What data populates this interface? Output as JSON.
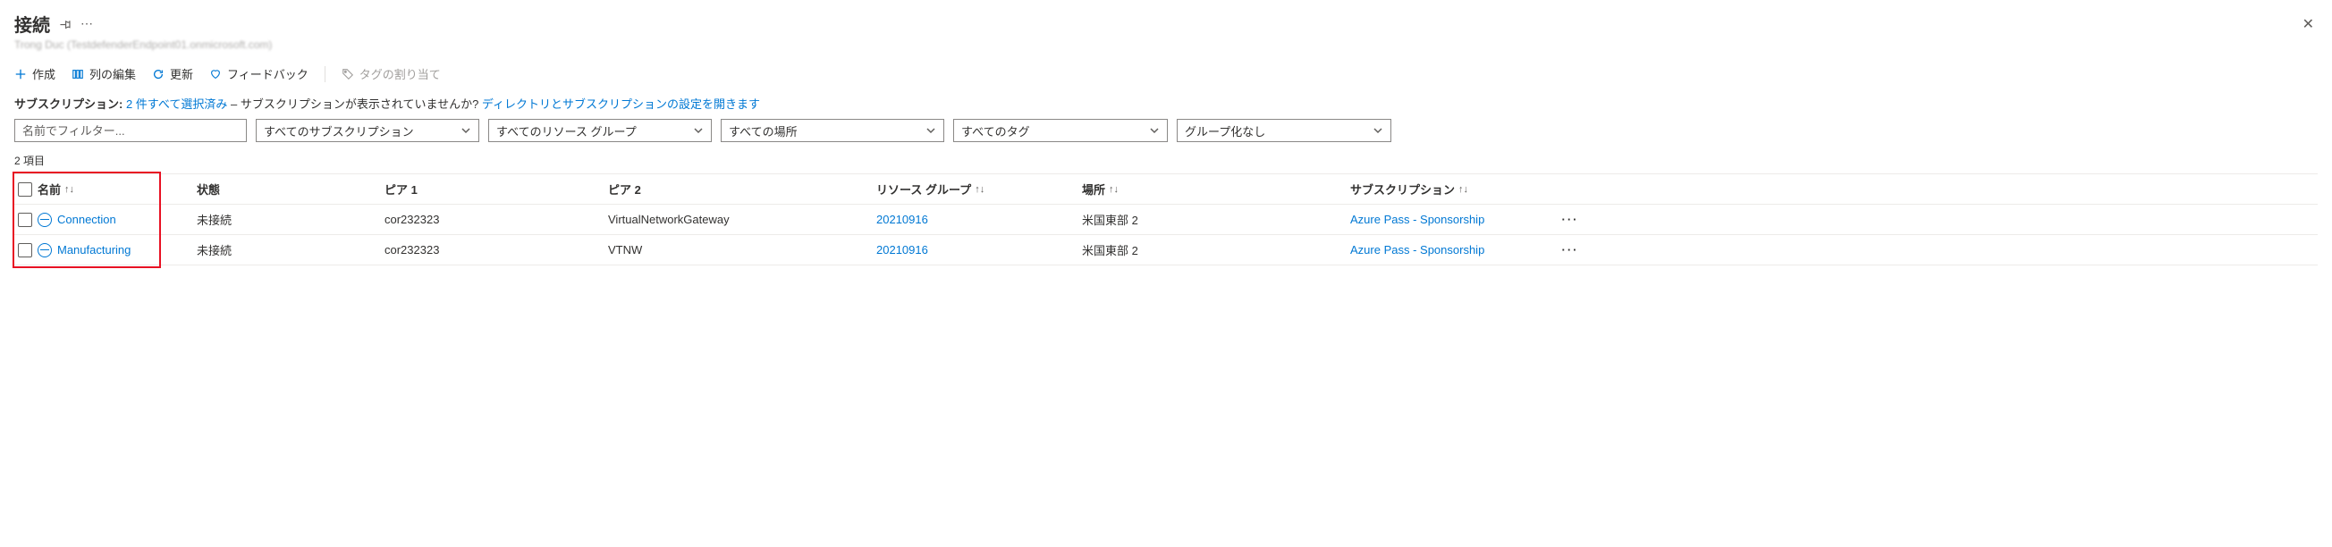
{
  "header": {
    "title": "接続",
    "subtitle": "Trong Duc (TestdefenderEndpoint01.onmicrosoft.com)"
  },
  "toolbar": {
    "create": "作成",
    "edit_columns": "列の編集",
    "refresh": "更新",
    "feedback": "フィードバック",
    "assign_tag": "タグの割り当て"
  },
  "sub_line": {
    "label": "サブスクリプション:",
    "selected": "2 件すべて選択済み",
    "mid": " – サブスクリプションが表示されていませんか? ",
    "link": "ディレクトリとサブスクリプションの設定を開きます"
  },
  "filters": {
    "name_placeholder": "名前でフィルター...",
    "subscription": "すべてのサブスクリプション",
    "resource_group": "すべてのリソース グループ",
    "location": "すべての場所",
    "tag": "すべてのタグ",
    "grouping": "グループ化なし"
  },
  "count_label": "2 項目",
  "columns": {
    "name": "名前",
    "status": "状態",
    "peer1": "ピア 1",
    "peer2": "ピア 2",
    "resource_group": "リソース グループ",
    "location": "場所",
    "subscription": "サブスクリプション"
  },
  "rows": [
    {
      "name": "Connection",
      "status": "未接続",
      "peer1": "cor232323",
      "peer2": "VirtualNetworkGateway",
      "resource_group": "20210916",
      "location": "米国東部 2",
      "subscription": "Azure Pass - Sponsorship"
    },
    {
      "name": "Manufacturing",
      "status": "未接続",
      "peer1": "cor232323",
      "peer2": "VTNW",
      "resource_group": "20210916",
      "location": "米国東部 2",
      "subscription": "Azure Pass - Sponsorship"
    }
  ]
}
